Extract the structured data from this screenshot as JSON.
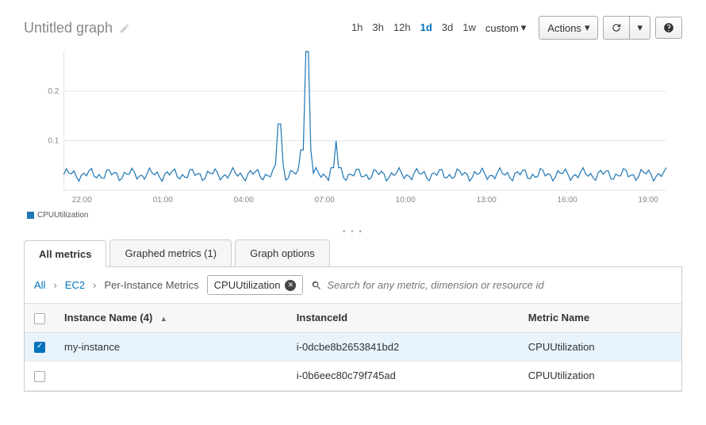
{
  "title": "Untitled graph",
  "time_ranges": [
    "1h",
    "3h",
    "12h",
    "1d",
    "3d",
    "1w"
  ],
  "active_range": "1d",
  "custom_label": "custom",
  "actions_label": "Actions",
  "legend_label": "CPUUtilization",
  "chart_data": {
    "type": "line",
    "title": "",
    "xlabel": "",
    "ylabel": "",
    "ylim": [
      0,
      0.28
    ],
    "x_ticks": [
      "22:00",
      "01:00",
      "04:00",
      "07:00",
      "10:00",
      "13:00",
      "16:00",
      "19:00"
    ],
    "y_ticks": [
      0.1,
      0.2
    ],
    "series": [
      {
        "name": "CPUUtilization",
        "color": "#1f77b4",
        "baseline": 0.032,
        "noise_amp": 0.014,
        "spikes": [
          {
            "x_frac": 0.358,
            "value": 0.134
          },
          {
            "x_frac": 0.402,
            "value": 0.28
          },
          {
            "x_frac": 0.452,
            "value": 0.1
          }
        ]
      }
    ]
  },
  "tabs": [
    {
      "id": "all",
      "label": "All metrics",
      "active": true
    },
    {
      "id": "graphed",
      "label": "Graphed metrics (1)",
      "active": false
    },
    {
      "id": "options",
      "label": "Graph options",
      "active": false
    }
  ],
  "breadcrumb": {
    "root": "All",
    "items": [
      "EC2",
      "Per-Instance Metrics"
    ]
  },
  "filter_chip": "CPUUtilization",
  "search_placeholder": "Search for any metric, dimension or resource id",
  "table": {
    "columns": [
      "Instance Name",
      "InstanceId",
      "Metric Name"
    ],
    "count_suffix": "(4)",
    "rows": [
      {
        "selected": true,
        "name": "my-instance",
        "instance_id": "i-0dcbe8b2653841bd2",
        "metric": "CPUUtilization"
      },
      {
        "selected": false,
        "name": "",
        "instance_id": "i-0b6eec80c79f745ad",
        "metric": "CPUUtilization"
      }
    ]
  }
}
